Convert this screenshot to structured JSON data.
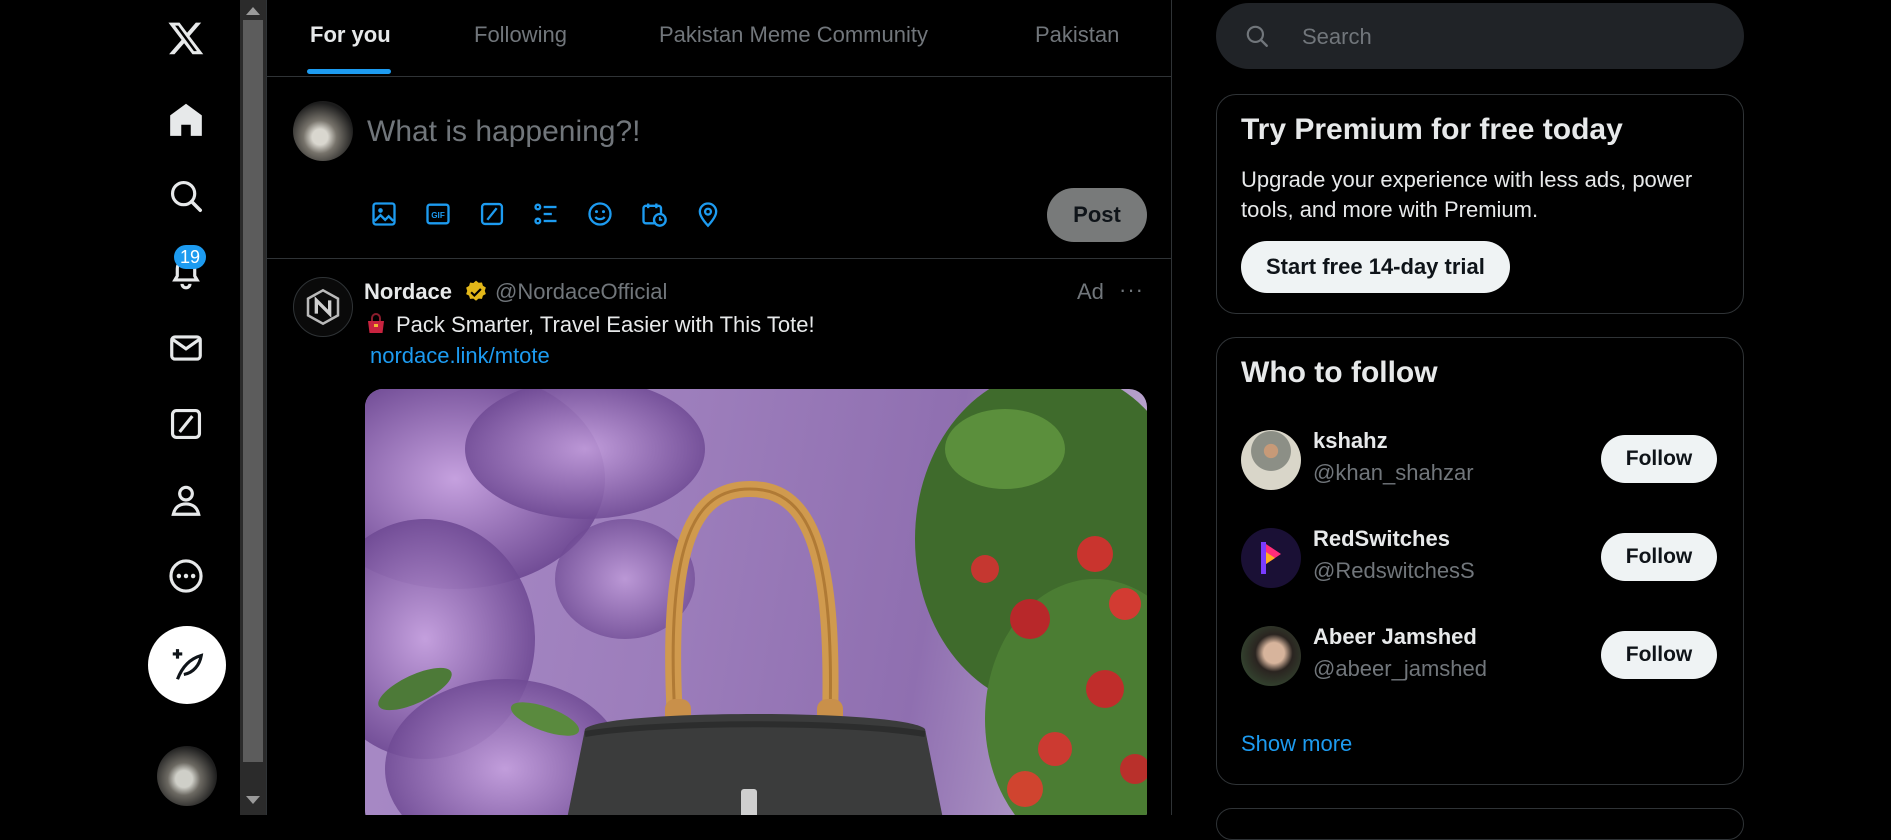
{
  "nav": {
    "notifications_count": "19",
    "items": [
      "x-logo-icon",
      "home-icon",
      "search-icon",
      "bell-icon",
      "mail-icon",
      "grok-icon",
      "profile-icon",
      "more-icon"
    ]
  },
  "tabs": [
    {
      "label": "For you",
      "active": true
    },
    {
      "label": "Following",
      "active": false
    },
    {
      "label": "Pakistan Meme Community",
      "active": false
    },
    {
      "label": "Pakistan",
      "active": false
    }
  ],
  "composer": {
    "placeholder": "What is happening?!",
    "post_label": "Post",
    "tools": [
      "image-icon",
      "gif-icon",
      "grok-icon",
      "poll-icon",
      "emoji-icon",
      "schedule-icon",
      "location-icon"
    ]
  },
  "tweet": {
    "name": "Nordace",
    "handle": "@NordaceOfficial",
    "ad_label": "Ad",
    "more": "···",
    "text": "Pack Smarter, Travel Easier with This Tote!",
    "link": "nordace.link/mtote"
  },
  "search": {
    "placeholder": "Search"
  },
  "premium": {
    "title": "Try Premium for free today",
    "body": "Upgrade your experience with less ads, power tools, and more with Premium.",
    "button": "Start free 14-day trial"
  },
  "who_to_follow": {
    "title": "Who to follow",
    "users": [
      {
        "name": "kshahz",
        "handle": "@khan_shahzar",
        "button": "Follow"
      },
      {
        "name": "RedSwitches",
        "handle": "@RedswitchesS",
        "button": "Follow"
      },
      {
        "name": "Abeer Jamshed",
        "handle": "@abeer_jamshed",
        "button": "Follow"
      }
    ],
    "show_more": "Show more"
  },
  "colors": {
    "accent": "#1d9bf0",
    "background": "#000000",
    "border": "#2f3336",
    "muted": "#71767b"
  }
}
